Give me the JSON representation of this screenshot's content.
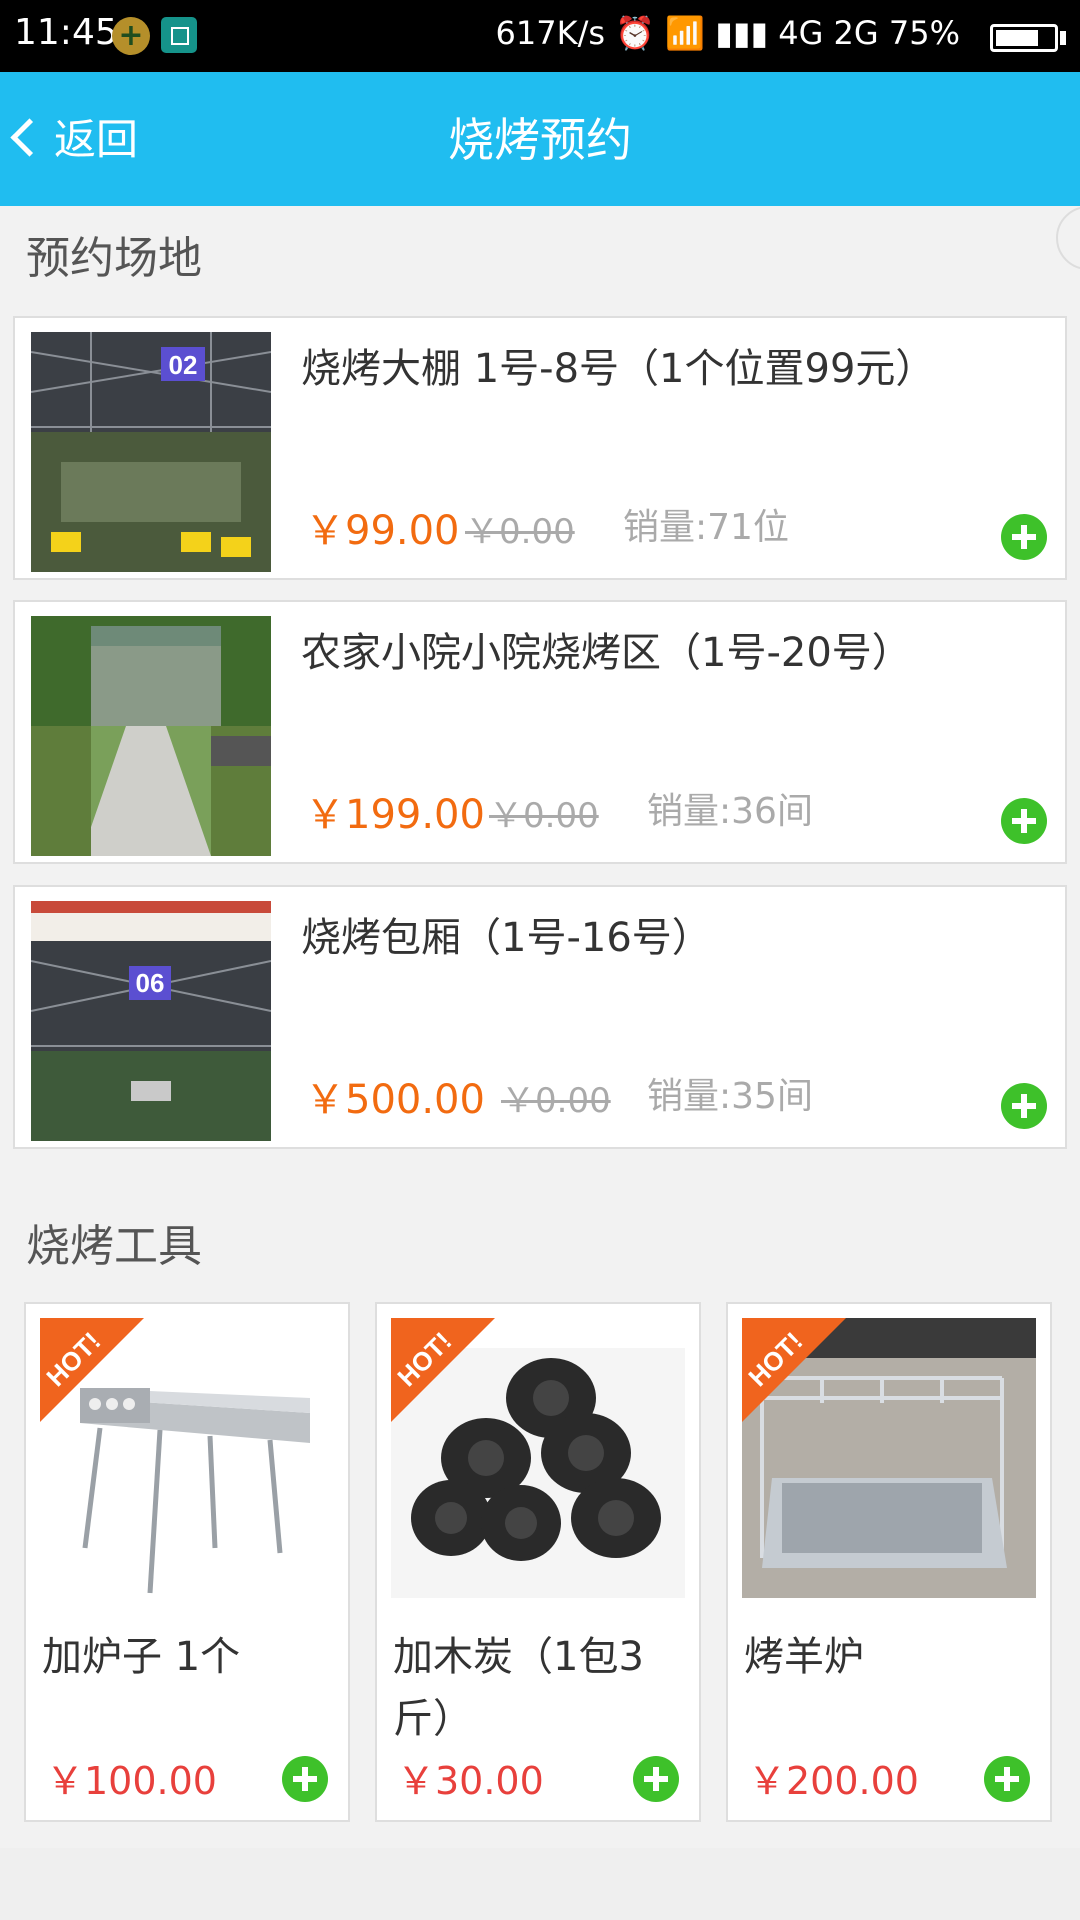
{
  "status_bar": {
    "time": "11:45",
    "right_text": "617K/s ⏰ 📶 ▮▮▮ 4G 2G",
    "battery": "75%",
    "battery_level": 0.75
  },
  "title_bar": {
    "back_label": "返回",
    "title": "烧烤预约",
    "accent": "#20bdf0"
  },
  "venues_section": {
    "header": "预约场地",
    "items": [
      {
        "title": "烧烤大棚 1号-8号（1个位置99元）",
        "price": "￥99.00",
        "old_price": "￥0.00",
        "sales": "销量:71位",
        "image": "bbq-shed-02-photo"
      },
      {
        "title": "农家小院小院烧烤区（1号-20号）",
        "price": "￥199.00",
        "old_price": "￥0.00",
        "sales": "销量:36间",
        "image": "courtyard-path-photo"
      },
      {
        "title": "烧烤包厢（1号-16号）",
        "price": "￥500.00",
        "old_price": "￥0.00",
        "sales": "销量:35间",
        "image": "bbq-shed-06-photo"
      }
    ]
  },
  "tools_section": {
    "header": "烧烤工具",
    "hot_label": "HOT!",
    "items": [
      {
        "name": "加炉子 1个",
        "price": "￥100.00",
        "image": "grill-stand-photo"
      },
      {
        "name": "加木炭（1包3斤）",
        "price": "￥30.00",
        "image": "charcoal-photo"
      },
      {
        "name": "烤羊炉",
        "price": "￥200.00",
        "image": "lamb-roaster-photo"
      }
    ]
  },
  "colors": {
    "price_orange": "#f26b10",
    "price_red": "#e8403c",
    "add_green": "#3ec12a"
  }
}
